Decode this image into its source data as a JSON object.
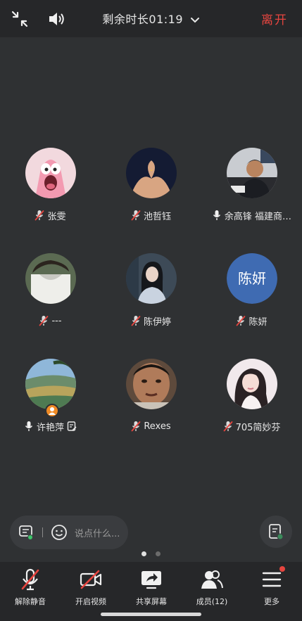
{
  "header": {
    "timer": "剩余时长01:19",
    "leave_label": "离开",
    "icons": [
      "shrink-icon",
      "speaker-icon",
      "chevron-down-icon"
    ]
  },
  "participants": [
    {
      "name": "张雯",
      "mic": "muted",
      "avatar": "patrick-star"
    },
    {
      "name": "池哲钰",
      "mic": "muted",
      "avatar": "heart-hands"
    },
    {
      "name": "余高锋 福建商…",
      "mic": "on",
      "avatar": "man-office"
    },
    {
      "name": "---",
      "mic": "muted",
      "avatar": "kaul-shirt"
    },
    {
      "name": "陈伊婷",
      "mic": "muted",
      "avatar": "woman-sweater"
    },
    {
      "name": "陈妍",
      "mic": "muted",
      "avatar_text": "陈妍"
    },
    {
      "name": "许艳萍",
      "mic": "on",
      "avatar": "landscape",
      "host": true,
      "note": true
    },
    {
      "name": "Rexes",
      "mic": "muted",
      "avatar": "selfie"
    },
    {
      "name": "705简妙芬",
      "mic": "muted",
      "avatar": "girl-portrait"
    }
  ],
  "chat": {
    "placeholder": "说点什么..."
  },
  "pager": {
    "pages": 2,
    "current": 1
  },
  "toolbar": {
    "unmute": "解除静音",
    "video": "开启视频",
    "share": "共享屏幕",
    "members": "成员(12)",
    "more": "更多"
  },
  "colors": {
    "background": "#2f3133",
    "bar": "#262729",
    "leave": "#e6453f",
    "muted_slash": "#e6453f",
    "avatar_text_bg": "#3f6bb2"
  }
}
